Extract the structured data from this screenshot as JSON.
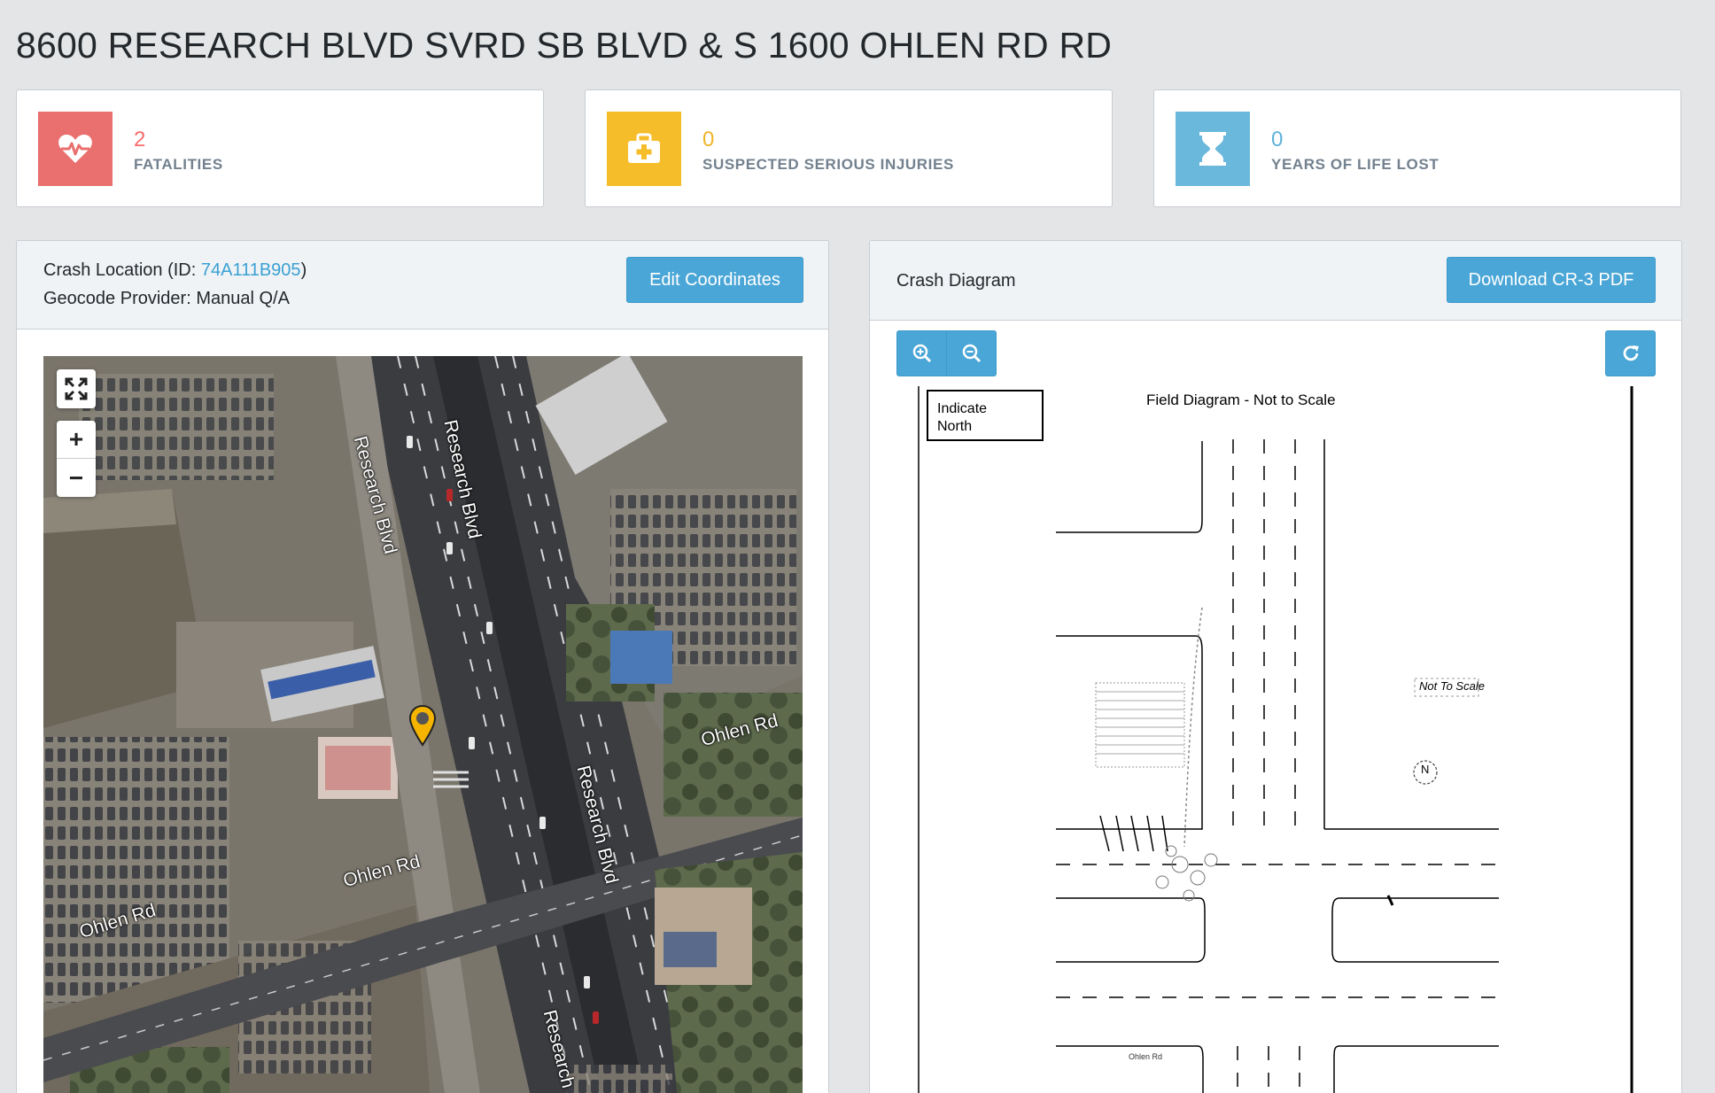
{
  "page": {
    "title": "8600 RESEARCH BLVD SVRD SB BLVD & S 1600 OHLEN RD RD"
  },
  "stats": [
    {
      "value": "2",
      "label": "FATALITIES",
      "icon": "heartbeat-icon",
      "color": "#f86c6b",
      "icon_bg": "#e9706e"
    },
    {
      "value": "0",
      "label": "SUSPECTED SERIOUS INJURIES",
      "icon": "medkit-icon",
      "color": "#f0b429",
      "icon_bg": "#f6bd2b"
    },
    {
      "value": "0",
      "label": "YEARS OF LIFE LOST",
      "icon": "hourglass-icon",
      "color": "#5eb3d9",
      "icon_bg": "#6ab8db"
    }
  ],
  "location_panel": {
    "label_prefix": "Crash Location (ID: ",
    "location_id": "74A111B905",
    "label_suffix": ")",
    "geocode_line": "Geocode Provider: Manual Q/A",
    "edit_button": "Edit Coordinates",
    "map": {
      "road_labels": {
        "research_blvd_top": "Research Blvd",
        "research_blvd_left": "Research Blvd",
        "research_blvd_mid": "Research Blvd",
        "research_bottom": "Research",
        "ohlen_rd_right": "Ohlen Rd",
        "ohlen_rd_mid": "Ohlen Rd",
        "ohlen_rd_left": "Ohlen Rd"
      },
      "controls": {
        "fullscreen": "fullscreen-icon",
        "zoom_in": "+",
        "zoom_out": "−"
      }
    }
  },
  "diagram_panel": {
    "title": "Crash Diagram",
    "download_button": "Download CR-3 PDF",
    "toolbar": {
      "zoom_in": "zoom-in-icon",
      "zoom_out": "zoom-out-icon",
      "reset": "refresh-icon"
    },
    "diagram": {
      "north_box": [
        "Indicate",
        "North"
      ],
      "heading": "Field Diagram - Not to Scale",
      "not_to_scale": "Not To Scale",
      "north_symbol": "N",
      "street_note": "Ohlen Rd"
    }
  },
  "colors": {
    "accent": "#4aa6d6",
    "link": "#3aa0d4",
    "marker": "#f4b400"
  }
}
